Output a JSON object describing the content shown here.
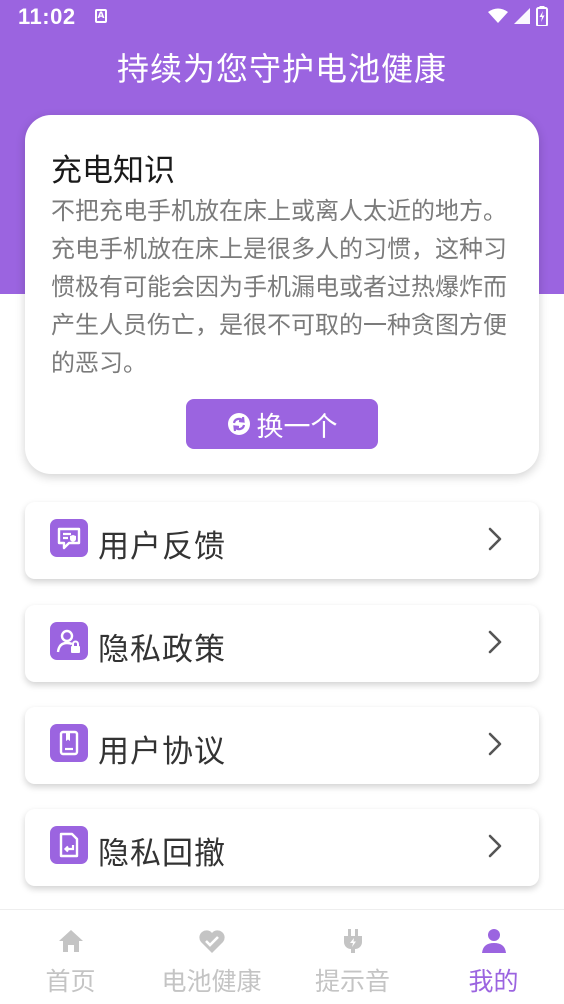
{
  "status_bar": {
    "time": "11:02",
    "notification_icon": "A"
  },
  "header": {
    "title": "持续为您守护电池健康"
  },
  "knowledge_card": {
    "title": "充电知识",
    "text": "不把充电手机放在床上或离人太近的地方。充电手机放在床上是很多人的习惯，这种习惯极有可能会因为手机漏电或者过热爆炸而产生人员伤亡，是很不可取的一种贪图方便的恶习。",
    "button_label": "换一个"
  },
  "menu": [
    {
      "label": "用户反馈",
      "icon": "feedback-icon"
    },
    {
      "label": "隐私政策",
      "icon": "privacy-policy-icon"
    },
    {
      "label": "用户协议",
      "icon": "user-agreement-icon"
    },
    {
      "label": "隐私回撤",
      "icon": "privacy-revoke-icon"
    }
  ],
  "bottom_nav": [
    {
      "label": "首页",
      "icon": "home-icon",
      "active": false
    },
    {
      "label": "电池健康",
      "icon": "heart-icon",
      "active": false
    },
    {
      "label": "提示音",
      "icon": "plug-icon",
      "active": false
    },
    {
      "label": "我的",
      "icon": "user-icon",
      "active": true
    }
  ],
  "colors": {
    "accent": "#9b64e0",
    "inactive": "#c4c4c4",
    "text_dark": "#333333",
    "text_gray": "#7b7b7b"
  }
}
